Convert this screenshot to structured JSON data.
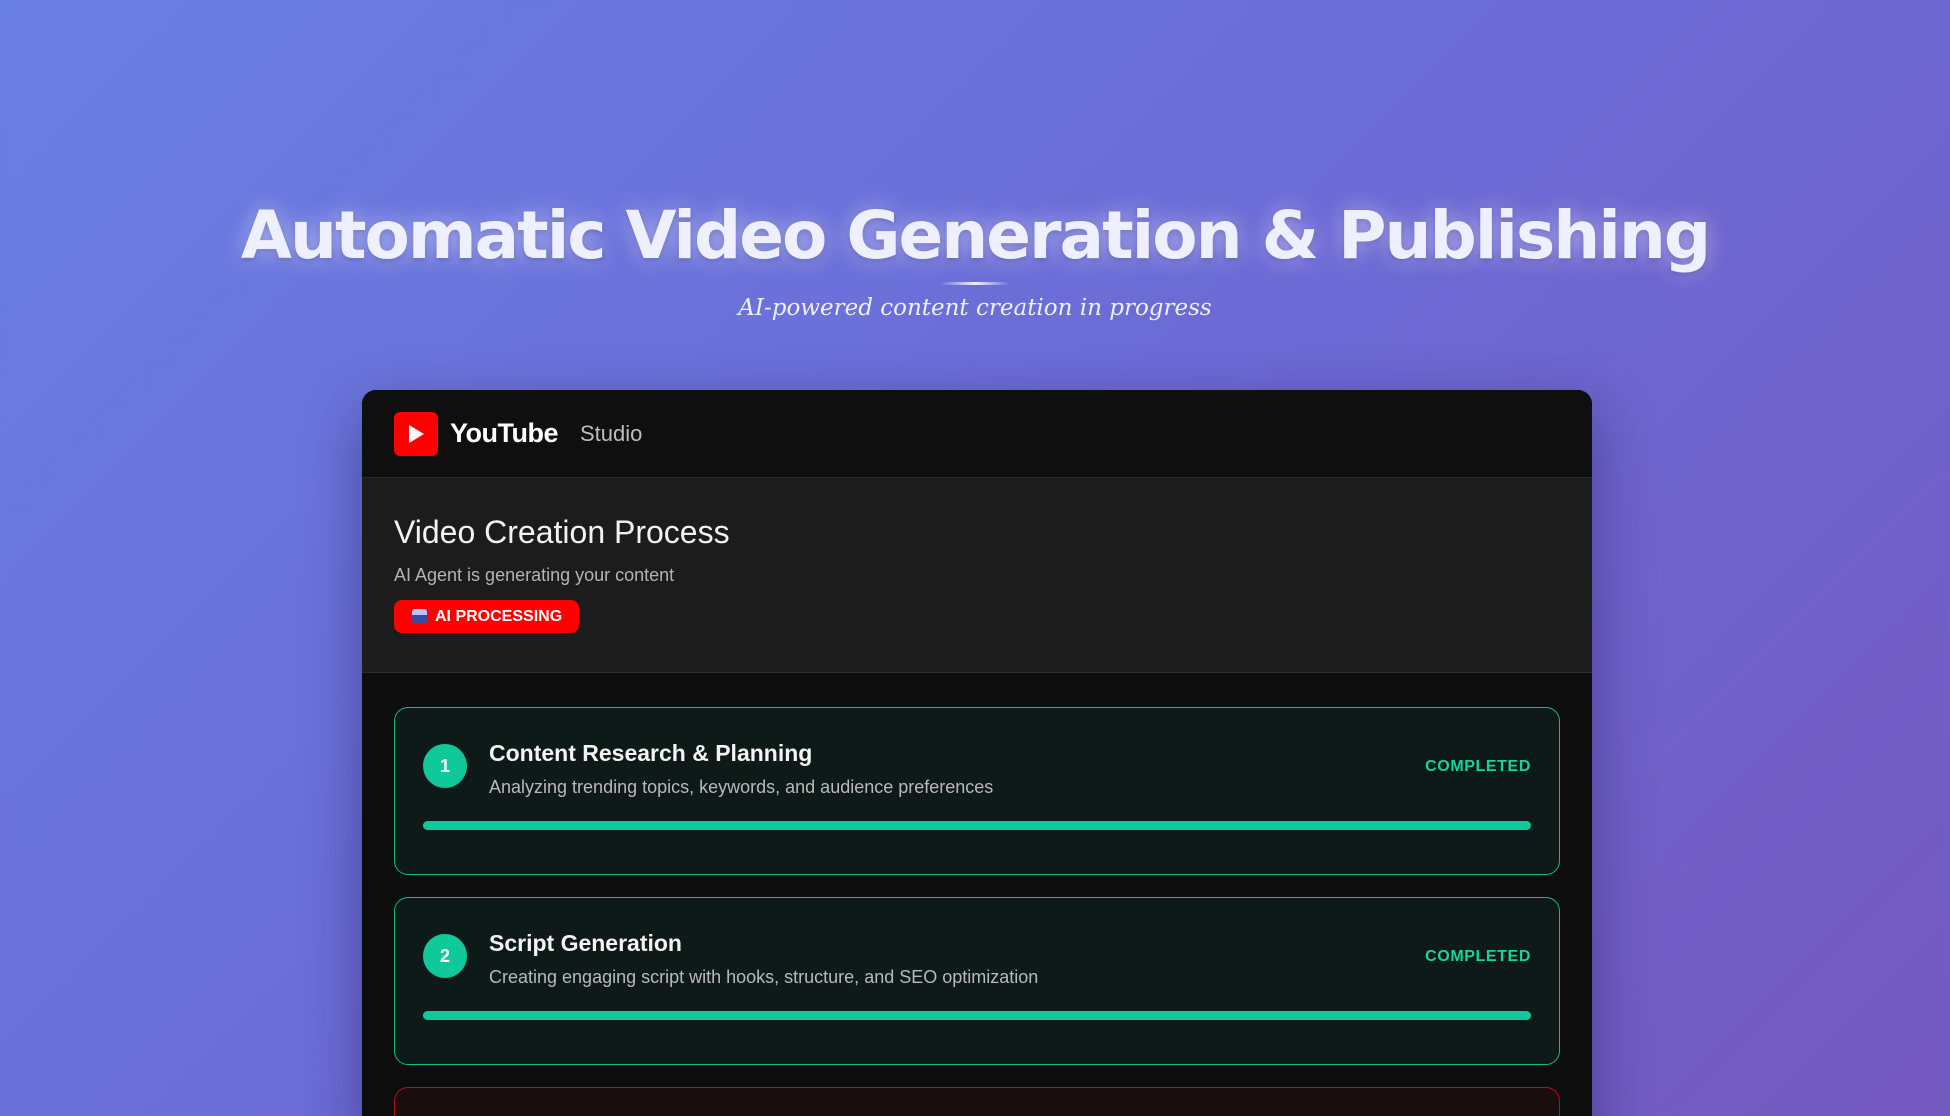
{
  "hero": {
    "title": "Automatic Video Generation & Publishing",
    "subtitle": "AI-powered content creation in progress"
  },
  "studio": {
    "brand": "YouTube",
    "brand_sub": "Studio",
    "logo_icon": "youtube-play-icon",
    "accent_color": "#ff0000",
    "process": {
      "title": "Video Creation Process",
      "subtitle": "AI Agent is generating your content",
      "badge": "AI PROCESSING",
      "badge_icon": "robot-icon"
    },
    "steps": [
      {
        "number": "1",
        "title": "Content Research & Planning",
        "description": "Analyzing trending topics, keywords, and audience preferences",
        "status": "COMPLETED",
        "progress": 1.0,
        "color": "#10c99a"
      },
      {
        "number": "2",
        "title": "Script Generation",
        "description": "Creating engaging script with hooks, structure, and SEO optimization",
        "status": "COMPLETED",
        "progress": 1.0,
        "color": "#10c99a"
      }
    ],
    "next_step_color": "#b3121a"
  }
}
